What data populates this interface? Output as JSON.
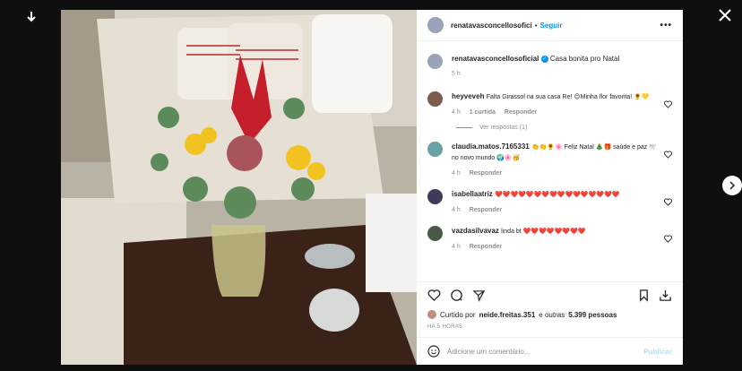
{
  "post": {
    "username": "renatavasconcellosofici",
    "follow": "Seguir",
    "more": "•••",
    "dot": "•"
  },
  "caption": {
    "username": "renatavasconcellosoficial",
    "text": "Casa bonita pro Natal",
    "time": "5 h"
  },
  "comments": [
    {
      "username": "heyveveh",
      "text": "Falta Girassol na sua casa Re! 😉Minha flor favorita! 🌻💛",
      "time": "4 h",
      "likes": "1 curtida",
      "reply": "Responder",
      "view_replies": "Ver respostas (1)"
    },
    {
      "username": "claudia.matos.7165331",
      "text": "👏👏🌻🌸 Feliz Natal 🎄🎁 saúde e paz 🕊️ no novo mundo 🌍🌸🥳",
      "time": "4 h",
      "reply": "Responder"
    },
    {
      "username": "isabellaatriz",
      "text": "❤️❤️❤️❤️❤️❤️❤️❤️❤️❤️❤️❤️❤️❤️❤️❤️",
      "time": "4 h",
      "reply": "Responder"
    },
    {
      "username": "vazdasilvavaz",
      "text": "linda bt ❤️❤️❤️❤️❤️❤️❤️❤️",
      "time": "4 h",
      "reply": "Responder"
    }
  ],
  "likes": {
    "prefix": "Curtido por",
    "user": "neide.freitas.351",
    "middle": "e outras",
    "count": "5.399 pessoas"
  },
  "posted": "HÁ 5 HORAS",
  "add_comment": {
    "placeholder": "Adicione um comentário...",
    "post": "Publicar"
  },
  "colors": {
    "accent": "#0095f6",
    "heart": "#ed4956"
  }
}
